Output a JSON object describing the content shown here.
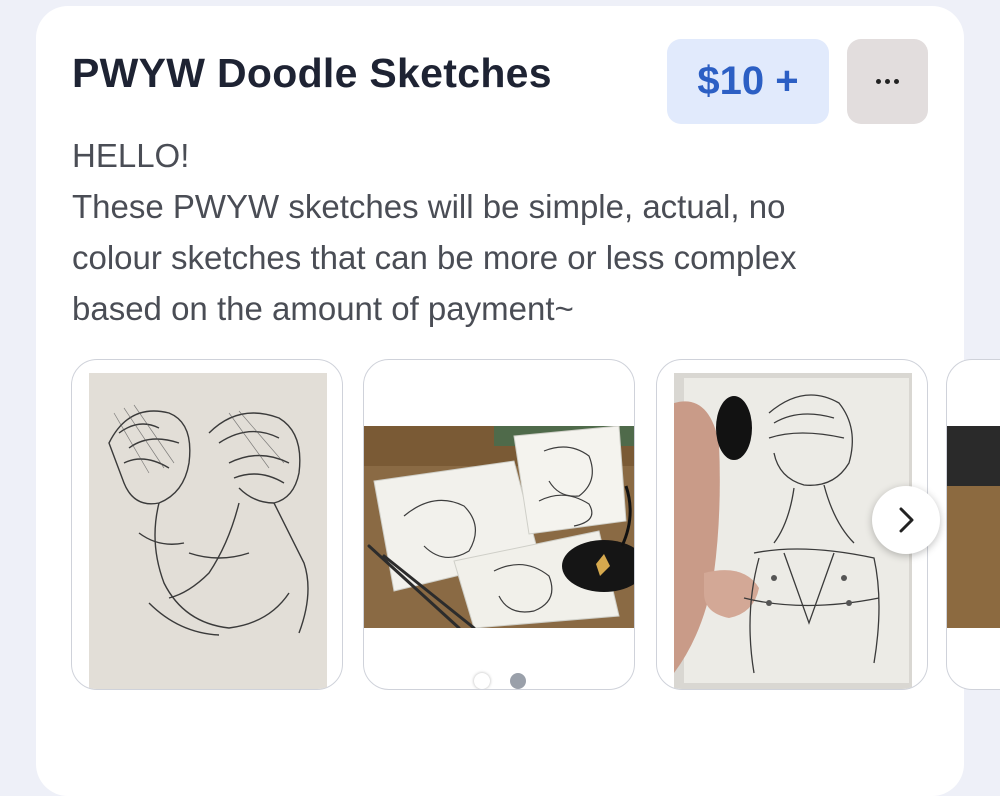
{
  "listing": {
    "title": "PWYW Doodle Sketches",
    "price_label": "$10 +",
    "more_icon": "more-horizontal-icon",
    "description_lines": [
      "HELLO!",
      "These PWYW sketches will be simple, actual, no",
      "colour sketches that can be more or less complex",
      "based on the amount of payment~"
    ]
  },
  "gallery": {
    "images": [
      "sketch of two characters in profile on paper",
      "photo of several sketch cards on a desk with pens",
      "hand holding a sketch of a long-haired character"
    ],
    "next_icon": "chevron-right-icon",
    "page_count": 2,
    "active_page": 1
  },
  "colors": {
    "card_bg": "#ffffff",
    "page_bg": "#eef0f8",
    "price_bg": "#e1eafc",
    "price_text": "#2c5fc4",
    "more_bg": "#e2dddd"
  }
}
